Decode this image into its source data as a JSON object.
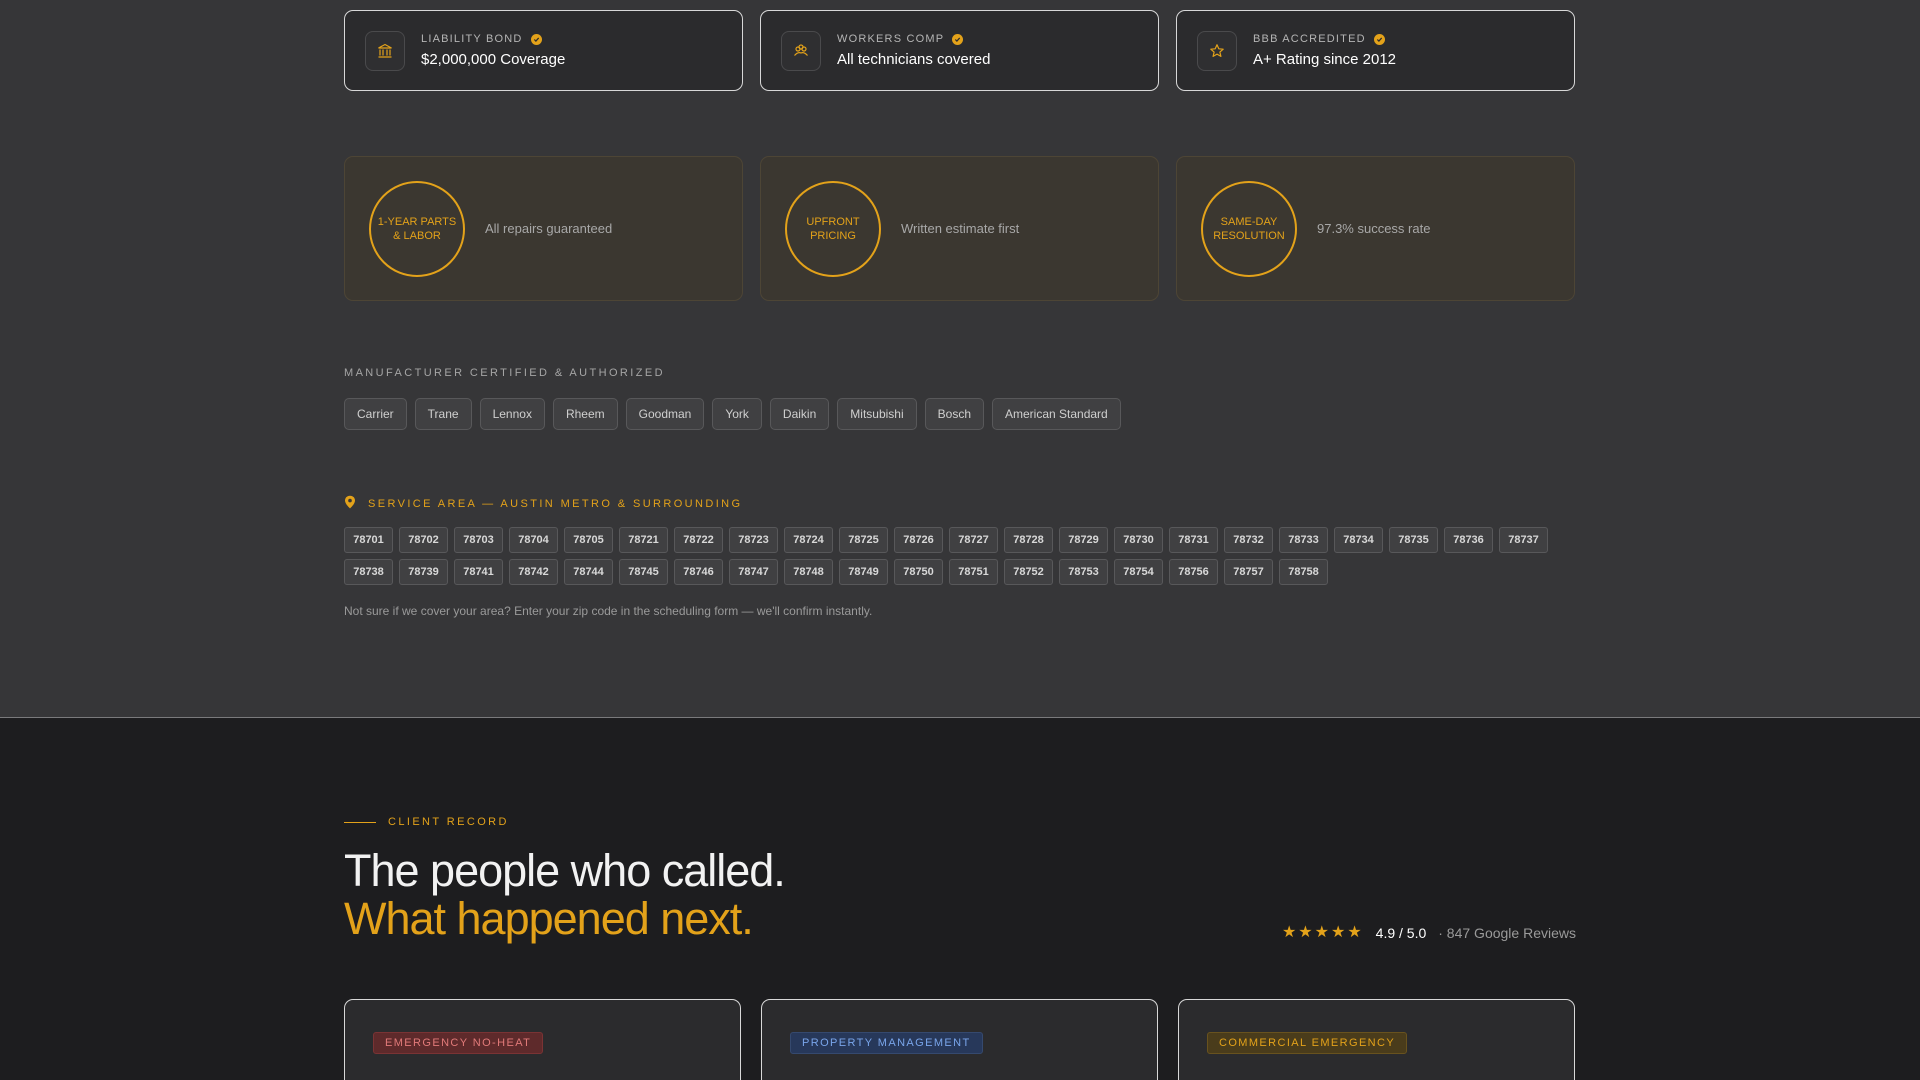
{
  "credentials": [
    {
      "label": "LIABILITY BOND",
      "value": "$2,000,000 Coverage",
      "icon": "bank-icon"
    },
    {
      "label": "WORKERS COMP",
      "value": "All technicians covered",
      "icon": "team-icon"
    },
    {
      "label": "BBB ACCREDITED",
      "value": "A+ Rating since 2012",
      "icon": "star-icon"
    }
  ],
  "guarantees": [
    {
      "badge": "1-YEAR PARTS & LABOR",
      "text": "All repairs guaranteed"
    },
    {
      "badge": "UPFRONT PRICING",
      "text": "Written estimate first"
    },
    {
      "badge": "SAME-DAY RESOLUTION",
      "text": "97.3% success rate"
    }
  ],
  "manufacturers": {
    "heading": "MANUFACTURER CERTIFIED & AUTHORIZED",
    "brands": [
      "Carrier",
      "Trane",
      "Lennox",
      "Rheem",
      "Goodman",
      "York",
      "Daikin",
      "Mitsubishi",
      "Bosch",
      "American Standard"
    ]
  },
  "service_area": {
    "heading": "SERVICE AREA — AUSTIN METRO & SURROUNDING",
    "zips": [
      "78701",
      "78702",
      "78703",
      "78704",
      "78705",
      "78721",
      "78722",
      "78723",
      "78724",
      "78725",
      "78726",
      "78727",
      "78728",
      "78729",
      "78730",
      "78731",
      "78732",
      "78733",
      "78734",
      "78735",
      "78736",
      "78737",
      "78738",
      "78739",
      "78741",
      "78742",
      "78744",
      "78745",
      "78746",
      "78747",
      "78748",
      "78749",
      "78750",
      "78751",
      "78752",
      "78753",
      "78754",
      "78756",
      "78757",
      "78758"
    ],
    "note": "Not sure if we cover your area? Enter your zip code in the scheduling form — we'll confirm instantly."
  },
  "client_record": {
    "eyebrow": "CLIENT RECORD",
    "headline_1": "The people who called.",
    "headline_2": "What happened next.",
    "rating_stars": 5,
    "rating": "4.9 / 5.0",
    "reviews_count": "· 847 Google Reviews",
    "reviews": [
      {
        "tag": "EMERGENCY NO-HEAT",
        "tag_color": "red"
      },
      {
        "tag": "PROPERTY MANAGEMENT",
        "tag_color": "blue"
      },
      {
        "tag": "COMMERCIAL EMERGENCY",
        "tag_color": "gold"
      }
    ]
  },
  "colors": {
    "accent": "#e3a21a",
    "background": "#363638",
    "dark_section": "#1d1d1f"
  }
}
